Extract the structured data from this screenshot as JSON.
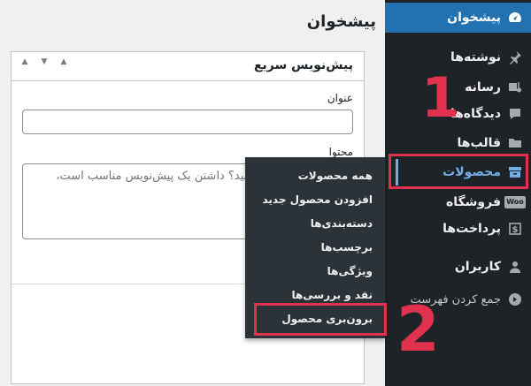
{
  "sidebar": {
    "items": [
      {
        "label": "پیشخوان",
        "icon": "dashboard-icon"
      },
      {
        "label": "نوشته‌ها",
        "icon": "pin-icon"
      },
      {
        "label": "رسانه",
        "icon": "media-icon"
      },
      {
        "label": "دیدگاه‌ها",
        "icon": "comment-icon"
      },
      {
        "label": "قالب‌ها",
        "icon": "folder-icon"
      },
      {
        "label": "محصولات",
        "icon": "archive-icon"
      },
      {
        "label": "فروشگاه",
        "icon": "woocommerce-icon",
        "badge": "Woo"
      },
      {
        "label": "پرداخت‌ها",
        "icon": "dollar-icon"
      },
      {
        "label": "کاربران",
        "icon": "user-icon"
      },
      {
        "label": "جمع کردن فهرست",
        "icon": "collapse-icon"
      }
    ]
  },
  "main": {
    "page_title": "پیشخوان",
    "widget": {
      "title": "پیش‌نویس سریع",
      "title_label": "عنوان",
      "content_label": "محتوا",
      "content_placeholder": "به چه چیزی می‌اندیشید؟ داشتن یک پیش‌نویس مناسب است، شمااست؟",
      "controls": [
        "▲",
        "▼",
        "▲"
      ]
    }
  },
  "flyout": {
    "items": [
      "همه محصولات",
      "افزودن محصول جدید",
      "دسته‌بندی‌ها",
      "برچسب‌ها",
      "ویژگی‌ها",
      "نقد و بررسی‌ها",
      "برون‌بری محصول"
    ]
  },
  "annotations": {
    "step1": "1",
    "step2": "2",
    "color": "#e0314e"
  },
  "colors": {
    "sidebar_bg": "#1d2327",
    "active_bg": "#2271b1",
    "current_text": "#72aee6",
    "flyout_bg": "#2c3338"
  }
}
